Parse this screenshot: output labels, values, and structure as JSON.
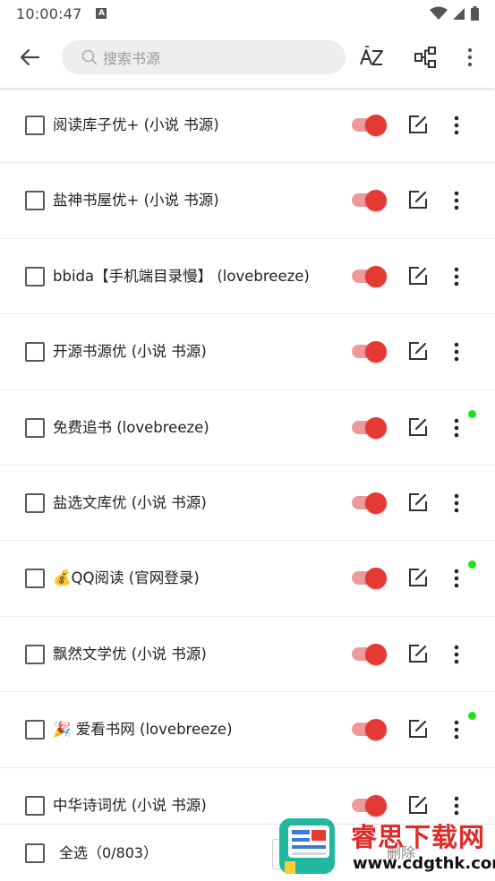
{
  "status_bar": {
    "time": "10:00:47",
    "notif_letter": "A"
  },
  "toolbar": {
    "search_placeholder": "搜索书源",
    "sort_label": "AZ"
  },
  "sources": [
    {
      "label": "阅读库子优+ (小说 书源)",
      "enabled": true,
      "new": false
    },
    {
      "label": "盐神书屋优+ (小说 书源)",
      "enabled": true,
      "new": false
    },
    {
      "label": "bbida【手机端目录慢】 (lovebreeze)",
      "enabled": true,
      "new": false
    },
    {
      "label": "开源书源优 (小说 书源)",
      "enabled": true,
      "new": false
    },
    {
      "label": "免费追书 (lovebreeze)",
      "enabled": true,
      "new": true
    },
    {
      "label": "盐选文库优 (小说 书源)",
      "enabled": true,
      "new": false
    },
    {
      "label": "💰QQ阅读 (官网登录)",
      "enabled": true,
      "new": true
    },
    {
      "label": "飘然文学优 (小说 书源)",
      "enabled": true,
      "new": false
    },
    {
      "label": "🎉 爱看书网 (lovebreeze)",
      "enabled": true,
      "new": true
    },
    {
      "label": "中华诗词优 (小说 书源)",
      "enabled": true,
      "new": false
    }
  ],
  "bottom_bar": {
    "select_all": "全选（0/803）",
    "delete": "删除"
  },
  "watermark": {
    "title": "睿思下载网",
    "url": "www.cdgthk.com"
  },
  "colors": {
    "accent": "#e53935",
    "accent_track": "#ef9a9a",
    "new_dot": "#1ee01e"
  }
}
